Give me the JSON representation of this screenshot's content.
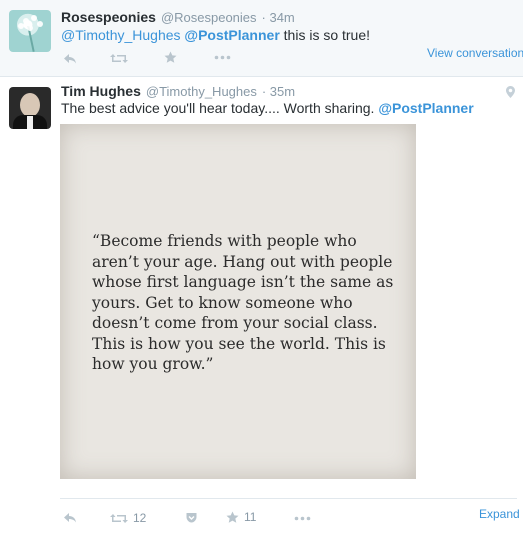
{
  "reply_tweet": {
    "name": "Rosespeonies",
    "handle": "@Rosespeonies",
    "time": "· 34m",
    "text_mention": "@Timothy_Hughes",
    "text_mention_bold": "@PostPlanner",
    "text_rest": "this is so true!",
    "view_conversation": "View conversation",
    "actions": {
      "reply_icon": "reply-icon",
      "retweet_icon": "retweet-icon",
      "favorite_icon": "star-icon",
      "more_icon": "more-icon"
    }
  },
  "main_tweet": {
    "name": "Tim Hughes",
    "handle": "@Timothy_Hughes",
    "time": "· 35m",
    "text": "The best advice you'll hear today.... Worth sharing.",
    "text_mention": "@PostPlanner",
    "photo_quote_lines": [
      "“Become friends with people who",
      "aren’t your age. Hang out with people",
      "whose first language isn’t the same as",
      "yours. Get to know someone who",
      "doesn’t come from your social class.",
      "This is how you see the world. This is",
      "how you grow.”"
    ],
    "retweet_count": "12",
    "favorite_count": "11",
    "expand_label": "Expand"
  },
  "colors": {
    "link": "#3b94d9",
    "muted": "#8899a6",
    "icon": "#b9c5cd",
    "reply_bg": "#f5f8fa"
  }
}
